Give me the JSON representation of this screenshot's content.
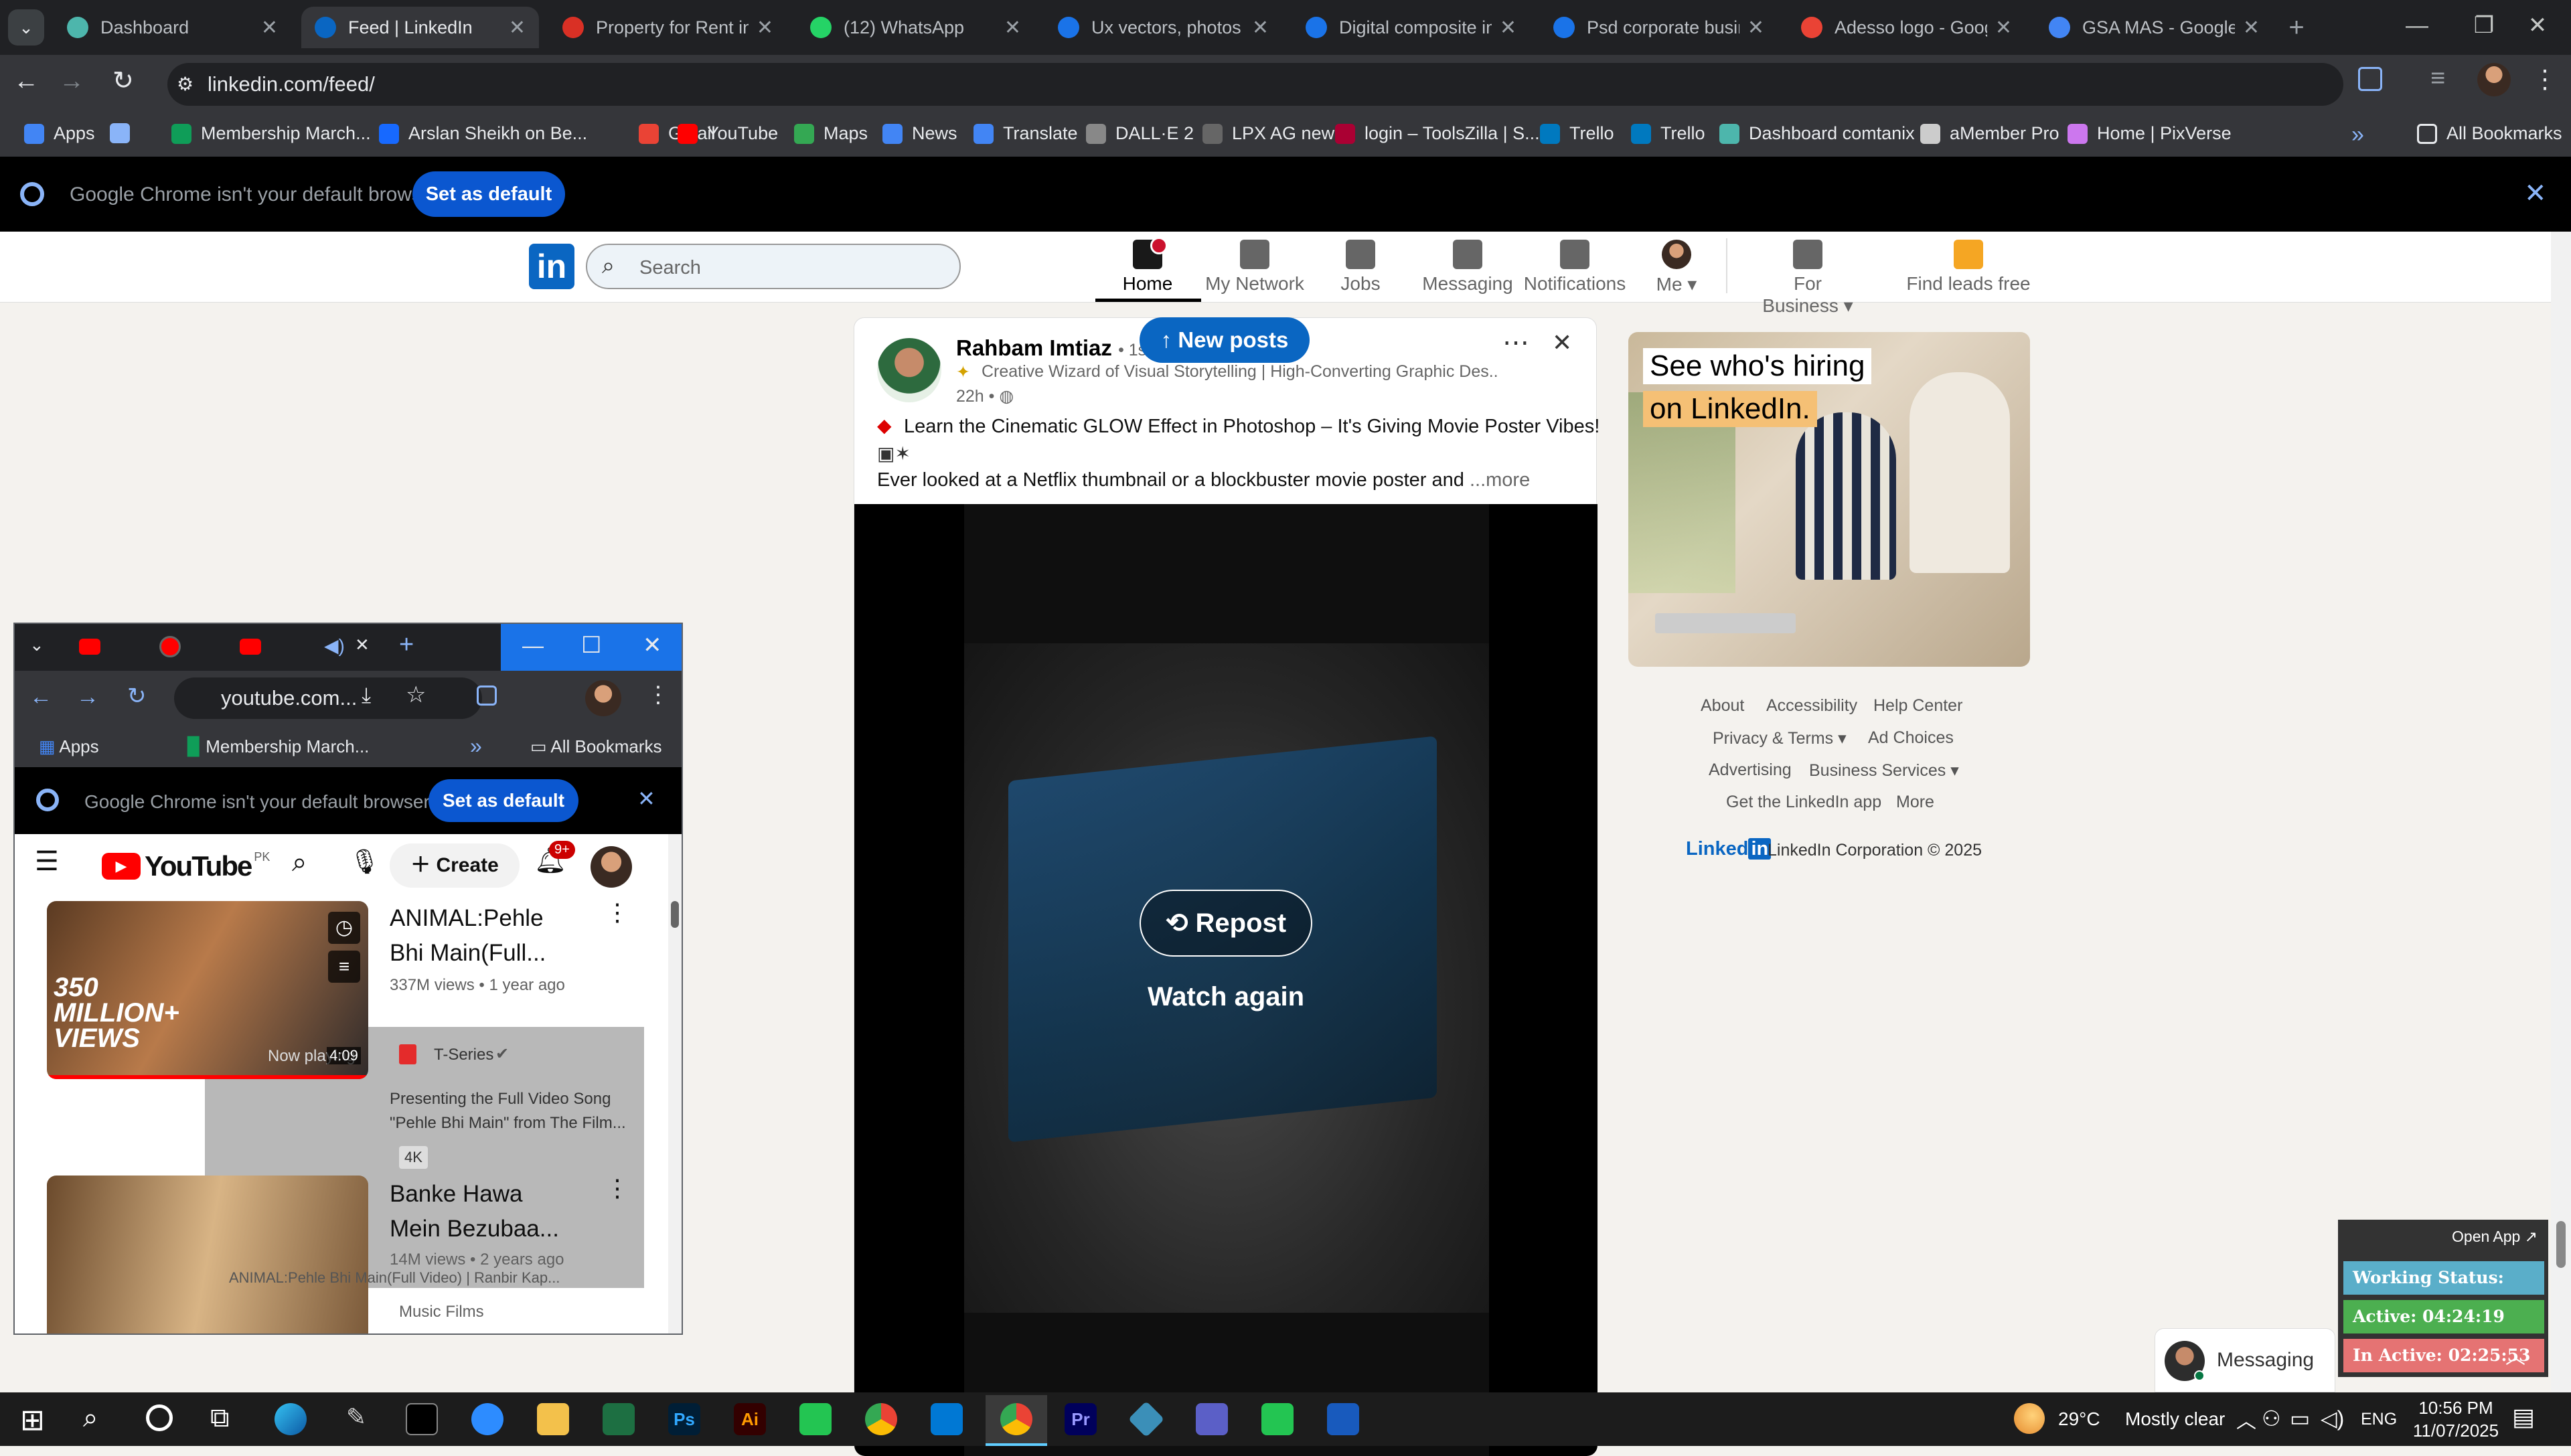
{
  "browser": {
    "tabs": [
      {
        "title": "Dashboard",
        "color": "#4db6ac"
      },
      {
        "title": "Feed | LinkedIn",
        "color": "#0a66c2"
      },
      {
        "title": "Property for Rent in I",
        "color": "#d93025"
      },
      {
        "title": "(12) WhatsApp",
        "color": "#25d366"
      },
      {
        "title": "Ux vectors, photos an",
        "color": "#1a73e8"
      },
      {
        "title": "Digital composite im",
        "color": "#1a73e8"
      },
      {
        "title": "Psd corporate busine",
        "color": "#1a73e8"
      },
      {
        "title": "Adesso logo - Googl",
        "color": "#ea4335"
      },
      {
        "title": "GSA MAS - Google S",
        "color": "#4285f4"
      }
    ],
    "url": "linkedin.com/feed/",
    "bookmarks": [
      {
        "label": "Apps",
        "color": "#4285f4"
      },
      {
        "label": "",
        "color": "#8ab4f8"
      },
      {
        "label": "Membership March...",
        "color": "#0f9d58"
      },
      {
        "label": "Arslan Sheikh on Be...",
        "color": "#1769ff"
      },
      {
        "label": "Gmail",
        "color": "#ea4335"
      },
      {
        "label": "YouTube",
        "color": "#ff0000"
      },
      {
        "label": "Maps",
        "color": "#34a853"
      },
      {
        "label": "News",
        "color": "#4285f4"
      },
      {
        "label": "Translate",
        "color": "#4285f4"
      },
      {
        "label": "DALL·E 2",
        "color": "#888"
      },
      {
        "label": "LPX AG new",
        "color": "#666"
      },
      {
        "label": "login – ToolsZilla | S...",
        "color": "#a03"
      },
      {
        "label": "Trello",
        "color": "#0079bf"
      },
      {
        "label": "Trello",
        "color": "#0079bf"
      },
      {
        "label": "Dashboard comtanix",
        "color": "#4db6ac"
      },
      {
        "label": "aMember Pro",
        "color": "#ccc"
      },
      {
        "label": "Home | PixVerse",
        "color": "#c7e"
      }
    ],
    "all_bookmarks": "All Bookmarks",
    "default_msg": "Google Chrome isn't your default browser",
    "set_default": "Set as default"
  },
  "linkedin": {
    "search_placeholder": "Search",
    "nav": [
      "Home",
      "My Network",
      "Jobs",
      "Messaging",
      "Notifications",
      "Me",
      "For Business",
      "Find leads free"
    ],
    "new_posts": "New posts",
    "post": {
      "author": "Rahbam Imtiaz",
      "degree": "• 1st",
      "headline": "Creative Wizard of Visual Storytelling | High-Converting Graphic Des...",
      "time": "22h •",
      "line1": "Learn the Cinematic GLOW Effect in Photoshop – It's Giving Movie Poster Vibes!",
      "line2": "Ever looked at a Netflix thumbnail or a blockbuster movie poster and",
      "more": "...more",
      "repost": "Repost",
      "watch_again": "Watch again"
    },
    "ad": {
      "line1": "See who's hiring",
      "line2": "on LinkedIn."
    },
    "footer": {
      "about": "About",
      "accessibility": "Accessibility",
      "help": "Help Center",
      "privacy": "Privacy & Terms",
      "ad_choices": "Ad Choices",
      "advertising": "Advertising",
      "business": "Business Services",
      "app": "Get the LinkedIn app",
      "more": "More",
      "brand": "Linked",
      "corp": "LinkedIn Corporation © 2025"
    },
    "messaging": "Messaging"
  },
  "youtube_window": {
    "url": "youtube.com...",
    "bookmarks": [
      "Apps",
      "Membership March...",
      "All Bookmarks"
    ],
    "default_msg": "Google Chrome isn't your default browser",
    "set_default": "Set as default",
    "logo": "YouTube",
    "region": "PK",
    "create": "Create",
    "notif_count": "9+",
    "videos": [
      {
        "title1": "ANIMAL:Pehle",
        "title2": "Bhi Main(Full...",
        "meta": "337M views • 1 year ago",
        "channel": "T-Series",
        "desc1": "Presenting the Full Video Song",
        "desc2": "\"Pehle Bhi Main\" from The Film...",
        "badge": "4K",
        "thumb_text": "350 MILLION+ VIEWS",
        "now_playing": "Now playing",
        "duration": "4:09"
      },
      {
        "title1": "Banke Hawa",
        "title2": "Mein Bezubaa...",
        "meta": "14M views • 2 years ago",
        "channel": "Music Films",
        "tooltip": "ANIMAL:Pehle Bhi Main(Full Video) | Ranbir Kap..."
      }
    ]
  },
  "widget": {
    "open_app": "Open App ↗",
    "working": "Working Status: Active",
    "active": "Active: 04:24:19",
    "inactive": "In Active: 02:25:53"
  },
  "taskbar": {
    "temp": "29°C",
    "weather": "Mostly clear",
    "lang": "ENG",
    "time": "10:56 PM",
    "date": "11/07/2025"
  }
}
